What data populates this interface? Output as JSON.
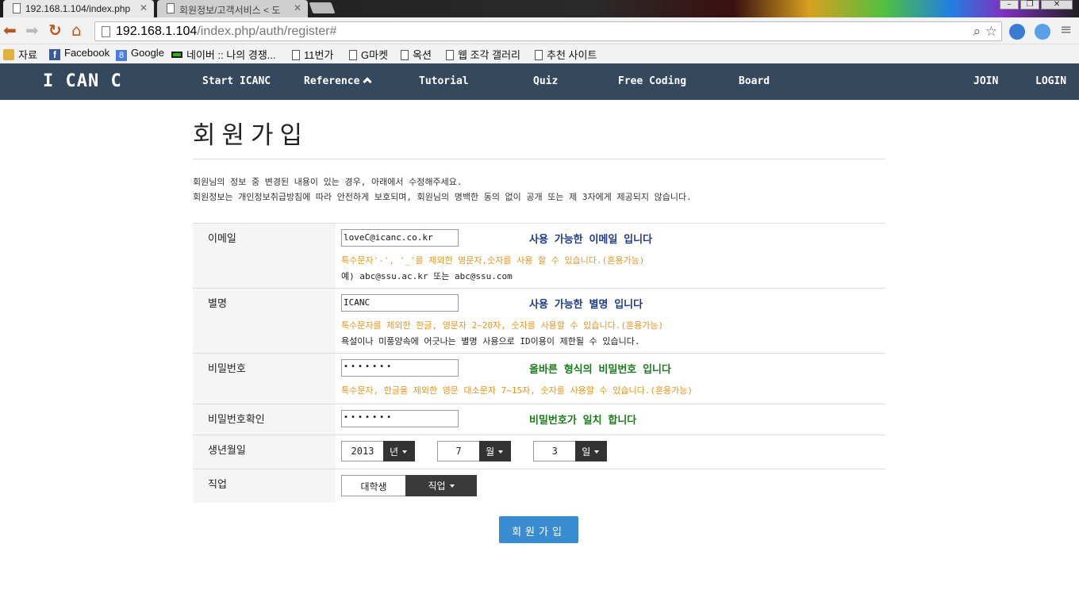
{
  "browser": {
    "tabs": [
      {
        "label": "192.168.1.104/index.php",
        "active": true
      },
      {
        "label": "회원정보/고객서비스 < 도",
        "active": false
      }
    ],
    "url_host": "192.168.1.104",
    "url_path": "/index.php/auth/register#",
    "bookmarks": [
      {
        "label": "자료",
        "icon": "folder-icon"
      },
      {
        "label": "Facebook",
        "icon": "facebook-icon"
      },
      {
        "label": "Google",
        "icon": "google-icon"
      },
      {
        "label": "네이버 :: 나의 경쟁...",
        "icon": "naver-icon"
      },
      {
        "label": "11번가",
        "icon": "page-icon"
      },
      {
        "label": "G마켓",
        "icon": "page-icon"
      },
      {
        "label": "옥션",
        "icon": "page-icon"
      },
      {
        "label": "웹 조각 갤러리",
        "icon": "page-icon"
      },
      {
        "label": "추천 사이트",
        "icon": "page-icon"
      }
    ]
  },
  "site_nav": {
    "brand": "I CAN C",
    "links": [
      "Start ICANC",
      "Reference",
      "Tutorial",
      "Quiz",
      "Free Coding",
      "Board"
    ],
    "join": "JOIN",
    "login": "LOGIN"
  },
  "page": {
    "title": "회원가입",
    "intro_line1": "회원님의 정보 중 변경된 내용이 있는 경우, 아래에서 수정해주세요.",
    "intro_line2": "회원정보는 개인정보취급방침에 따라 안전하게 보호되며, 회원님의 명백한 동의 없이 공개 또는 제 3자에게 제공되지 않습니다."
  },
  "form": {
    "email": {
      "label": "이메일",
      "value": "loveC@icanc.co.kr",
      "status": "사용 가능한 이메일 입니다",
      "hint": "특수문자'-', '_'를 제외한 영문자,숫자를 사용 할 수 있습니다.(혼용가능)",
      "note": "예) abc@ssu.ac.kr 또는 abc@ssu.com"
    },
    "nickname": {
      "label": "별명",
      "value": "ICANC",
      "status": "사용 가능한 별명 입니다",
      "hint": "특수문자를 제외한 한글, 영문자 2~20자, 숫자를 사용할 수 있습니다.(혼용가능)",
      "note": "욕설이나 미풍양속에 어긋나는 별명 사용으로 ID이용이 제한될 수 있습니다."
    },
    "password": {
      "label": "비밀번호",
      "value": "•••••••",
      "status": "올바른 형식의 비밀번호 입니다",
      "hint": "특수문자, 한글을 제외한 영문 대소문자 7~15자, 숫자를 사용할 수 있습니다.(혼용가능)"
    },
    "password_confirm": {
      "label": "비밀번호확인",
      "value": "•••••••",
      "status": "비밀번호가 일치 합니다"
    },
    "birth": {
      "label": "생년월일",
      "year": "2013",
      "year_unit": "년",
      "month": "7",
      "month_unit": "월",
      "day": "3",
      "day_unit": "일"
    },
    "job": {
      "label": "직업",
      "value": "대학생",
      "button": "직업"
    },
    "submit": "회원가입"
  },
  "colors": {
    "nav_bg": "#34495e",
    "ok_blue": "#1f3a8a",
    "ok_green": "#1b7a1b",
    "hint_orange": "#e8941a",
    "submit_bg": "#3a8cd0"
  }
}
